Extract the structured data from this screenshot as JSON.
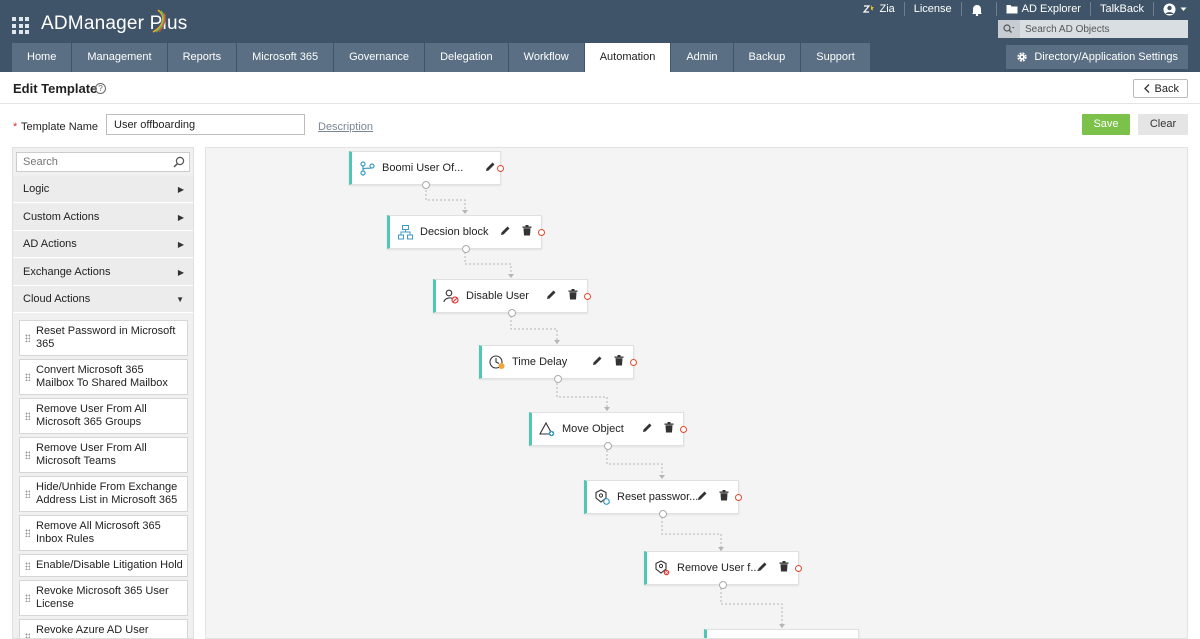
{
  "app": {
    "title": "ADManager Plus"
  },
  "top_links": {
    "zia": "Zia",
    "license": "License",
    "ad_explorer": "AD Explorer",
    "talkback": "TalkBack"
  },
  "search": {
    "placeholder": "Search AD Objects"
  },
  "tabs": [
    {
      "label": "Home"
    },
    {
      "label": "Management"
    },
    {
      "label": "Reports"
    },
    {
      "label": "Microsoft 365"
    },
    {
      "label": "Governance"
    },
    {
      "label": "Delegation"
    },
    {
      "label": "Workflow"
    },
    {
      "label": "Automation",
      "active": true
    },
    {
      "label": "Admin"
    },
    {
      "label": "Backup"
    },
    {
      "label": "Support"
    }
  ],
  "directory_settings": "Directory/Application Settings",
  "page": {
    "title": "Edit Template",
    "back_label": "Back",
    "required_mark": "*",
    "template_name_label": "Template Name",
    "template_name_value": "User offboarding",
    "description_link": "Description",
    "save_label": "Save",
    "clear_label": "Clear"
  },
  "left_panel": {
    "search_placeholder": "Search",
    "categories": [
      {
        "label": "Logic"
      },
      {
        "label": "Custom Actions"
      },
      {
        "label": "AD Actions"
      },
      {
        "label": "Exchange Actions"
      },
      {
        "label": "Cloud Actions",
        "expanded": true
      }
    ],
    "actions": [
      {
        "label": "Reset Password in Microsoft 365"
      },
      {
        "label": "Convert Microsoft 365 Mailbox To Shared Mailbox"
      },
      {
        "label": "Remove User From All Microsoft 365 Groups"
      },
      {
        "label": "Remove User From All Microsoft Teams"
      },
      {
        "label": "Hide/Unhide From Exchange Address List in Microsoft 365"
      },
      {
        "label": "Remove All Microsoft 365 Inbox Rules"
      },
      {
        "label": "Enable/Disable Litigation Hold"
      },
      {
        "label": "Revoke Microsoft 365 User License"
      },
      {
        "label": "Revoke Azure AD User Refresh Tokens"
      }
    ]
  },
  "canvas": {
    "accent_color": "#50c6b5",
    "nodes": [
      {
        "label": "Boomi User Of...",
        "icon": "branch-icon"
      },
      {
        "label": "Decsion block",
        "icon": "decision-icon"
      },
      {
        "label": "Disable User",
        "icon": "disable-user-icon"
      },
      {
        "label": "Time Delay",
        "icon": "clock-icon"
      },
      {
        "label": "Move Object",
        "icon": "move-object-icon"
      },
      {
        "label": "Reset passwor...",
        "icon": "reset-password-icon"
      },
      {
        "label": "Remove User f...",
        "icon": "remove-user-icon"
      }
    ]
  }
}
